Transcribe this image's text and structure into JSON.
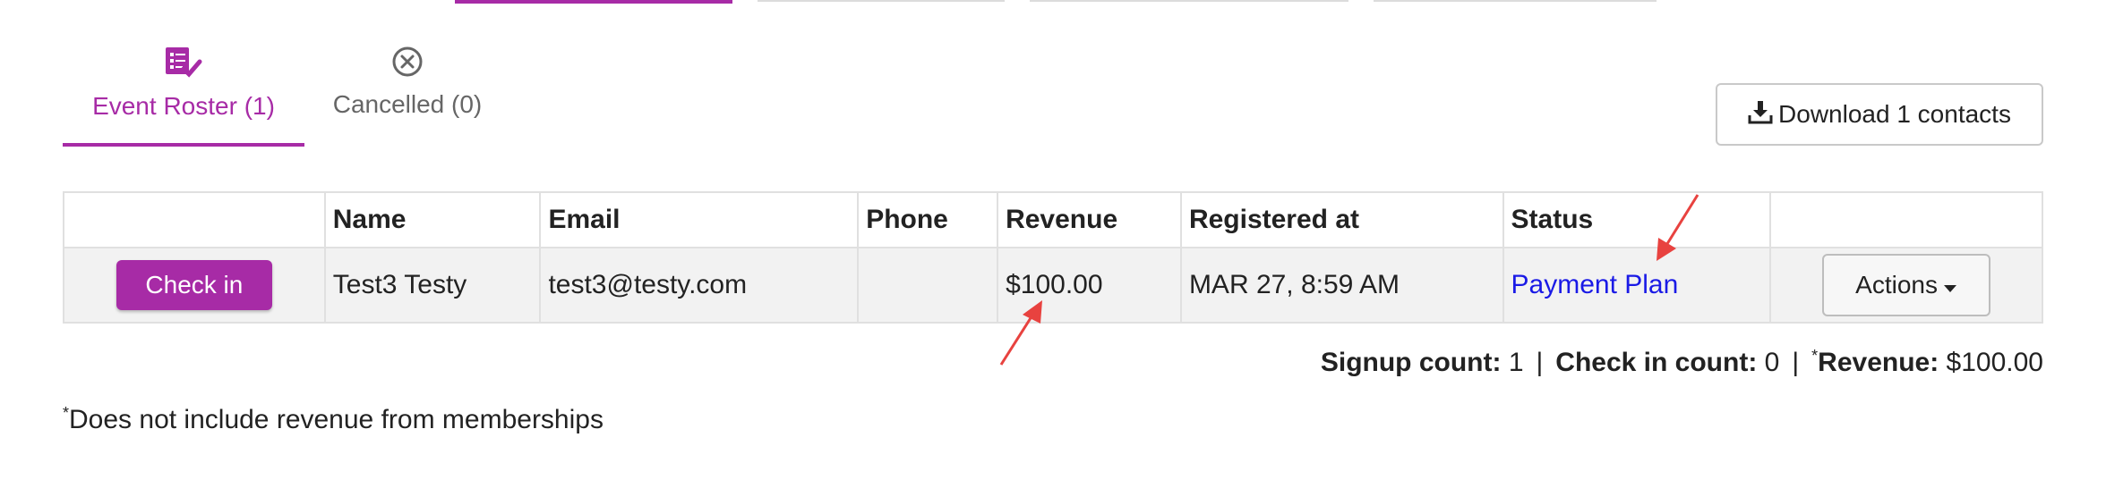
{
  "tabs": [
    {
      "label": "Event Roster (1)",
      "icon": "roster-check-icon",
      "active": true
    },
    {
      "label": "Cancelled (0)",
      "icon": "cancel-circle-icon",
      "active": false
    }
  ],
  "toolbar": {
    "download_label": "Download 1 contacts",
    "download_icon": "download-icon"
  },
  "table": {
    "headers": [
      "",
      "Name",
      "Email",
      "Phone",
      "Revenue",
      "Registered at",
      "Status",
      ""
    ],
    "rows": [
      {
        "checkin_label": "Check in",
        "name": "Test3 Testy",
        "email": "test3@testy.com",
        "phone": "",
        "revenue": "$100.00",
        "registered_at": "MAR 27, 8:59 AM",
        "status": "Payment Plan",
        "actions_label": "Actions"
      }
    ]
  },
  "summary": {
    "signup_label": "Signup count:",
    "signup_value": "1",
    "checkin_label": "Check in count:",
    "checkin_value": "0",
    "revenue_marker": "*",
    "revenue_label": "Revenue:",
    "revenue_value": "$100.00",
    "separator": "|"
  },
  "footnote": {
    "marker": "*",
    "text": "Does not include revenue from memberships"
  },
  "colors": {
    "accent": "#a72ba6",
    "link": "#1a1ae6",
    "annotation": "#e8423f"
  }
}
